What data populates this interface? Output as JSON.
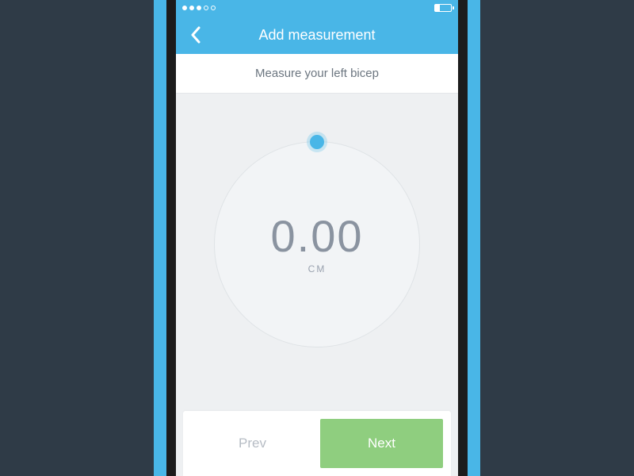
{
  "nav": {
    "title": "Add measurement"
  },
  "instruction": "Measure your left bicep",
  "dial": {
    "value": "0.00",
    "unit": "CM"
  },
  "buttons": {
    "prev": "Prev",
    "next": "Next"
  },
  "colors": {
    "accent": "#49b6e7",
    "next_button": "#8fce7f"
  }
}
